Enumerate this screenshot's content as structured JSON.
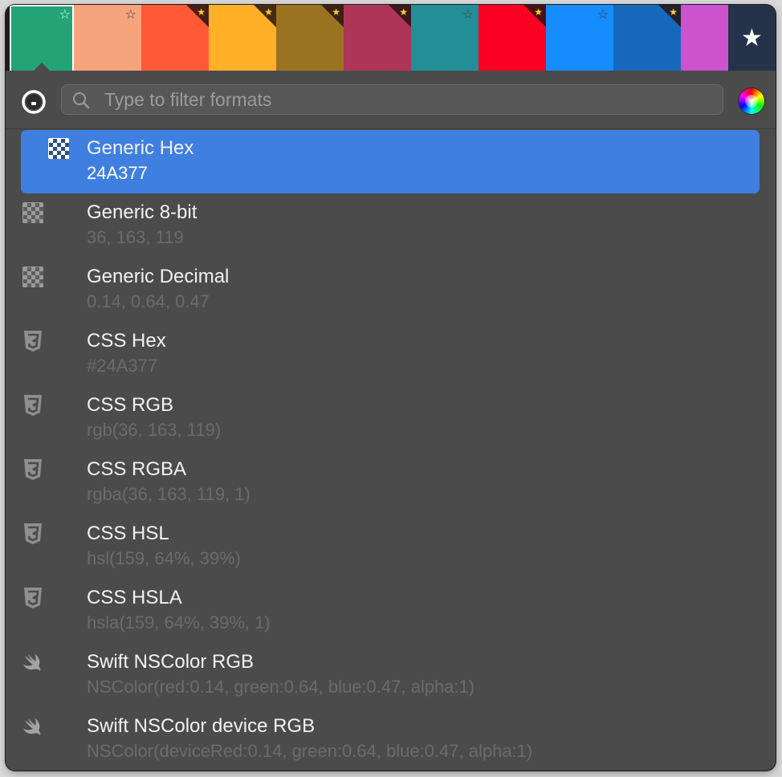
{
  "swatches": [
    {
      "color": "#24A377",
      "marker": "outline",
      "selected": true
    },
    {
      "color": "#F5A47E",
      "marker": "outline"
    },
    {
      "color": "#FF5A35",
      "marker": "corner"
    },
    {
      "color": "#FFB027",
      "marker": "corner"
    },
    {
      "color": "#9B7320",
      "marker": "corner"
    },
    {
      "color": "#AD3557",
      "marker": "corner"
    },
    {
      "color": "#238E98",
      "marker": "outline"
    },
    {
      "color": "#FA0022",
      "marker": "corner"
    },
    {
      "color": "#158CFF",
      "marker": "outline"
    },
    {
      "color": "#1768BD",
      "marker": "corner"
    },
    {
      "color": "#CD52CE",
      "marker": "none"
    }
  ],
  "favorites": {
    "icon": "star-icon",
    "glyph": "★"
  },
  "search": {
    "placeholder": "Type to filter formats",
    "value": ""
  },
  "formats": [
    {
      "title": "Generic Hex",
      "value": "24A377",
      "icon": "checkerboard-icon",
      "selected": true
    },
    {
      "title": "Generic 8-bit",
      "value": "36, 163, 119",
      "icon": "checkerboard-icon"
    },
    {
      "title": "Generic Decimal",
      "value": "0.14, 0.64, 0.47",
      "icon": "checkerboard-icon"
    },
    {
      "title": "CSS Hex",
      "value": "#24A377",
      "icon": "css3-icon"
    },
    {
      "title": "CSS RGB",
      "value": "rgb(36, 163, 119)",
      "icon": "css3-icon"
    },
    {
      "title": "CSS RGBA",
      "value": "rgba(36, 163, 119, 1)",
      "icon": "css3-icon"
    },
    {
      "title": "CSS HSL",
      "value": "hsl(159, 64%, 39%)",
      "icon": "css3-icon"
    },
    {
      "title": "CSS HSLA",
      "value": "hsla(159, 64%, 39%, 1)",
      "icon": "css3-icon"
    },
    {
      "title": "Swift NSColor RGB",
      "value": "NSColor(red:0.14, green:0.64, blue:0.47, alpha:1)",
      "icon": "swift-icon"
    },
    {
      "title": "Swift NSColor device RGB",
      "value": "NSColor(deviceRed:0.14, green:0.64, blue:0.47, alpha:1)",
      "icon": "swift-icon"
    }
  ],
  "colors": {
    "selection": "#3F7FE0",
    "background": "#4B4B4B",
    "secondary_text": "#6B6B6B"
  }
}
